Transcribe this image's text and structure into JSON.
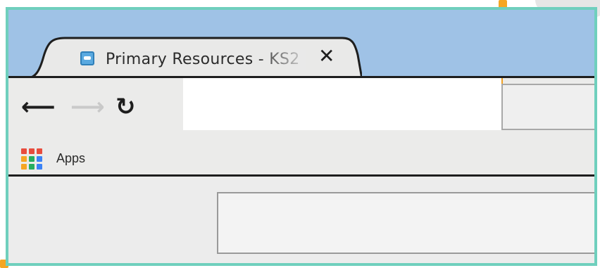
{
  "browser": {
    "tab": {
      "title": "Primary Resources - KS2",
      "favicon_icon": "school-cap-icon",
      "close_icon": "close-icon"
    },
    "toolbar": {
      "back_icon": "arrow-left-icon",
      "forward_icon": "arrow-right-icon",
      "reload_icon": "reload-icon",
      "address_value": ""
    },
    "bookmarks": {
      "apps_label": "Apps",
      "apps_icon": "apps-grid-icon",
      "apps_grid_colors": [
        "#e84c3d",
        "#e84c3d",
        "#e84c3d",
        "#f5a623",
        "#27ae60",
        "#3b82f6",
        "#f5a623",
        "#27ae60",
        "#3b82f6"
      ]
    }
  },
  "colors": {
    "frame": "#6fcfbd",
    "accent_orange": "#f5a623",
    "title_bar": "#9fc2e6",
    "toolbar_bg": "#ebebea"
  },
  "glyphs": {
    "back": "⟵",
    "forward": "⟶",
    "reload": "↻",
    "close": "✕"
  }
}
